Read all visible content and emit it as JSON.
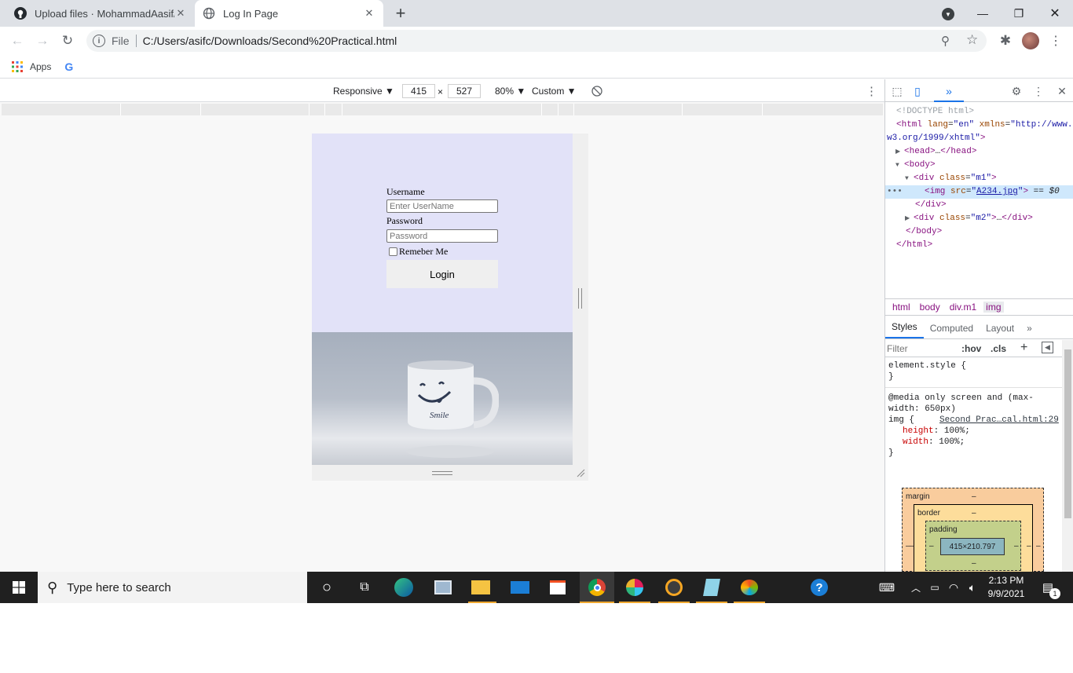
{
  "tabs": [
    {
      "title": "Upload files · MohammadAasif/L",
      "active": false
    },
    {
      "title": "Log In Page",
      "active": true
    }
  ],
  "new_tab_label": "+",
  "address_bar": {
    "scheme_label": "File",
    "url": "C:/Users/asifc/Downloads/Second%20Practical.html"
  },
  "bookmarks": {
    "apps_label": "Apps",
    "google_label": "G"
  },
  "device_toolbar": {
    "device": "Responsive",
    "width": "415",
    "height": "527",
    "times": "×",
    "zoom": "80%",
    "throttle": "Custom"
  },
  "login_form": {
    "username_label": "Username",
    "username_placeholder": "Enter UserName",
    "password_label": "Password",
    "password_placeholder": "Password",
    "remember_label": "Remeber Me",
    "login_button": "Login"
  },
  "mug_text": "Smile",
  "devtools": {
    "dom_lines": [
      {
        "indent": 14,
        "arrow": "",
        "html": "<span class='cmt'>&lt;!DOCTYPE html&gt;</span>"
      },
      {
        "indent": 14,
        "arrow": "",
        "html": "<span class='tag'>&lt;html</span> <span class='attr-n'>lang</span>=<span class='attr-v'>\"en\"</span> <span class='attr-n'>xmlns</span>=<span class='attr-v'>\"http://www.</span>"
      },
      {
        "indent": 2,
        "arrow": "",
        "html": "<span class='attr-v'>w3.org/1999/xhtml\"</span><span class='tag'>&gt;</span>"
      },
      {
        "indent": 24,
        "arrow": "▶",
        "html": "<span class='tag'>&lt;head&gt;</span>…<span class='tag'>&lt;/head&gt;</span>"
      },
      {
        "indent": 24,
        "arrow": "▼",
        "html": "<span class='tag'>&lt;body&gt;</span>"
      },
      {
        "indent": 36,
        "arrow": "▼",
        "html": "<span class='tag'>&lt;div</span> <span class='attr-n'>class</span>=<span class='attr-v'>\"m1\"</span><span class='tag'>&gt;</span>"
      },
      {
        "indent": 50,
        "arrow": "",
        "html": "<span class='tag'>&lt;img</span> <span class='attr-n'>src</span>=<span class='attr-v'>\"<u>A234.jpg</u>\"</span><span class='tag'>&gt;</span> == <i>$0</i>",
        "selected": true
      },
      {
        "indent": 38,
        "arrow": "",
        "html": "<span class='tag'>&lt;/div&gt;</span>"
      },
      {
        "indent": 36,
        "arrow": "▶",
        "html": "<span class='tag'>&lt;div</span> <span class='attr-n'>class</span>=<span class='attr-v'>\"m2\"</span><span class='tag'>&gt;</span>…<span class='tag'>&lt;/div&gt;</span>"
      },
      {
        "indent": 26,
        "arrow": "",
        "html": "<span class='tag'>&lt;/body&gt;</span>"
      },
      {
        "indent": 14,
        "arrow": "",
        "html": "<span class='tag'>&lt;/html&gt;</span>"
      }
    ],
    "breadcrumbs": [
      "html",
      "body",
      "div.m1",
      "img"
    ],
    "style_tabs": [
      "Styles",
      "Computed",
      "Layout",
      "»"
    ],
    "filter_placeholder": "Filter",
    "hov_label": ":hov",
    "cls_label": ".cls",
    "element_style": "element.style {",
    "close_brace": "}",
    "media_rule": "@media only screen and (max-width: 650px)",
    "selector": "img {",
    "source_link": "Second Prac…cal.html:29",
    "decl_1_prop": "height",
    "decl_1_val": "100%;",
    "decl_2_prop": "width",
    "decl_2_val": "100%;",
    "box_margin": "margin",
    "box_border": "border",
    "box_padding": "padding",
    "box_dash": "–",
    "box_content": "415×210.797"
  },
  "taskbar": {
    "search_placeholder": "Type here to search",
    "time": "2:13 PM",
    "date": "9/9/2021",
    "notifications": "1"
  },
  "colors": {
    "form_bg": "#e2e2f8",
    "accent_blue": "#1a73e8",
    "taskbar_bg": "#202020"
  }
}
